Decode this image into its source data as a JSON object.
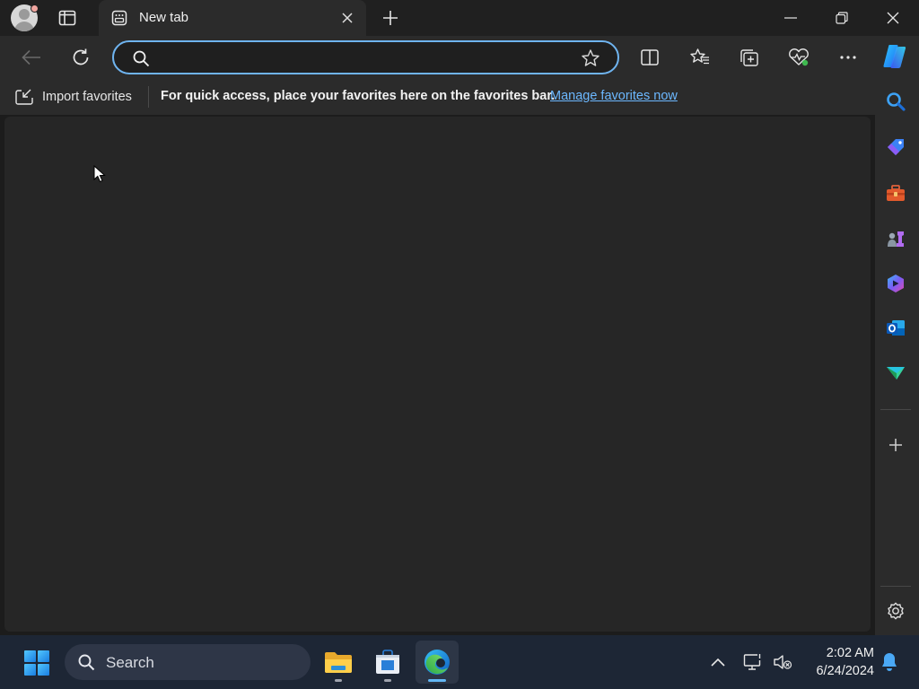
{
  "tab": {
    "title": "New tab"
  },
  "address": {
    "placeholder": "",
    "value": ""
  },
  "favorites_bar": {
    "import_label": "Import favorites",
    "message": "For quick access, place your favorites here on the favorites bar.",
    "manage_link": "Manage favorites now"
  },
  "taskbar": {
    "search_label": "Search",
    "time": "2:02 AM",
    "date": "6/24/2024"
  },
  "colors": {
    "accent": "#6fb4f0",
    "link": "#6cb8ff",
    "taskbar_bg": "#1d2635"
  },
  "icons": {
    "sidebar": [
      "search-icon",
      "shopping-tag-icon",
      "tools-icon",
      "games-icon",
      "copilot-app-icon",
      "outlook-icon",
      "send-icon",
      "add-icon",
      "settings-icon"
    ],
    "toolbar": [
      "back-icon",
      "refresh-icon",
      "split-screen-icon",
      "favorites-icon",
      "collections-icon",
      "browser-essentials-icon",
      "more-icon"
    ]
  }
}
